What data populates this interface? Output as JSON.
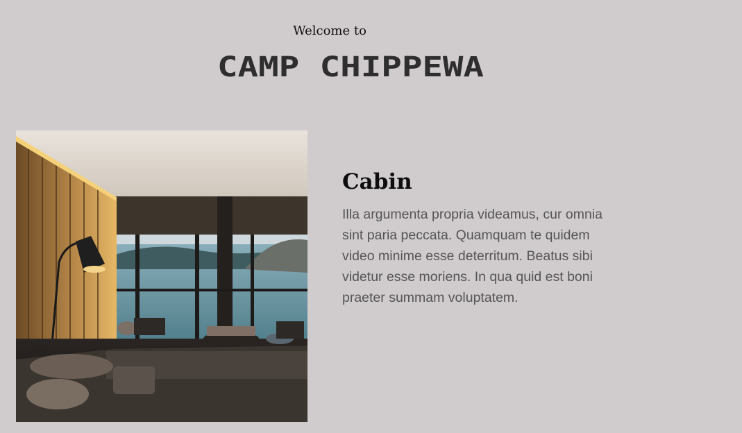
{
  "header": {
    "welcome": "Welcome to",
    "logo_text": "CAMP CHIPPEWA"
  },
  "feature": {
    "image_subject": "cabin interior with lake view",
    "title": "Cabin",
    "description": "Illa argumenta propria videamus, cur omnia sint paria peccata. Quamquam te quidem video minime esse deterritum. Beatus sibi videtur esse moriens. In qua quid est boni praeter summam voluptatem."
  },
  "colors": {
    "background": "#d0cbcc",
    "logo": "#2e2e2e",
    "title": "#0d0d0d",
    "body_text": "#555555"
  }
}
